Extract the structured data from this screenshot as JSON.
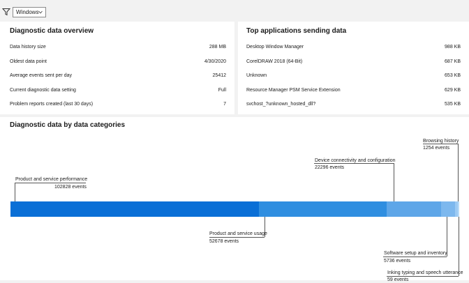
{
  "filter": {
    "selected": "Windows"
  },
  "overview": {
    "title": "Diagnostic data overview",
    "rows": [
      {
        "label": "Data history size",
        "value": "288 MB"
      },
      {
        "label": "Oldest data point",
        "value": "4/30/2020"
      },
      {
        "label": "Average events sent per day",
        "value": "25412"
      },
      {
        "label": "Current diagnostic data setting",
        "value": "Full"
      },
      {
        "label": "Problem reports created (last 30 days)",
        "value": "7"
      }
    ]
  },
  "apps": {
    "title": "Top applications sending data",
    "rows": [
      {
        "label": "Desktop Window Manager",
        "value": "988 KB"
      },
      {
        "label": "CorelDRAW 2018 (64-Bit)",
        "value": "687 KB"
      },
      {
        "label": "Unknown",
        "value": "653 KB"
      },
      {
        "label": "Resource Manager PSM Service Extension",
        "value": "629 KB"
      },
      {
        "label": "svchost_?unknown_hosted_dll?",
        "value": "535 KB"
      }
    ]
  },
  "categories": {
    "title": "Diagnostic data by data categories",
    "items": [
      {
        "name": "Product and service performance",
        "events": "102828 events",
        "count": 102828,
        "color": "#0a6fd6"
      },
      {
        "name": "Product and service usage",
        "events": "52678 events",
        "count": 52678,
        "color": "#2f8ee0"
      },
      {
        "name": "Device connectivity and configuration",
        "events": "22296 events",
        "count": 22296,
        "color": "#5ea6e8"
      },
      {
        "name": "Software setup and inventory",
        "events": "5736 events",
        "count": 5736,
        "color": "#7db8ee"
      },
      {
        "name": "Browsing history",
        "events": "1254 events",
        "count": 1254,
        "color": "#9ccaf3"
      },
      {
        "name": "Inking typing and speech utterance",
        "events": "59 events",
        "count": 59,
        "color": "#b8dbf8"
      }
    ]
  }
}
